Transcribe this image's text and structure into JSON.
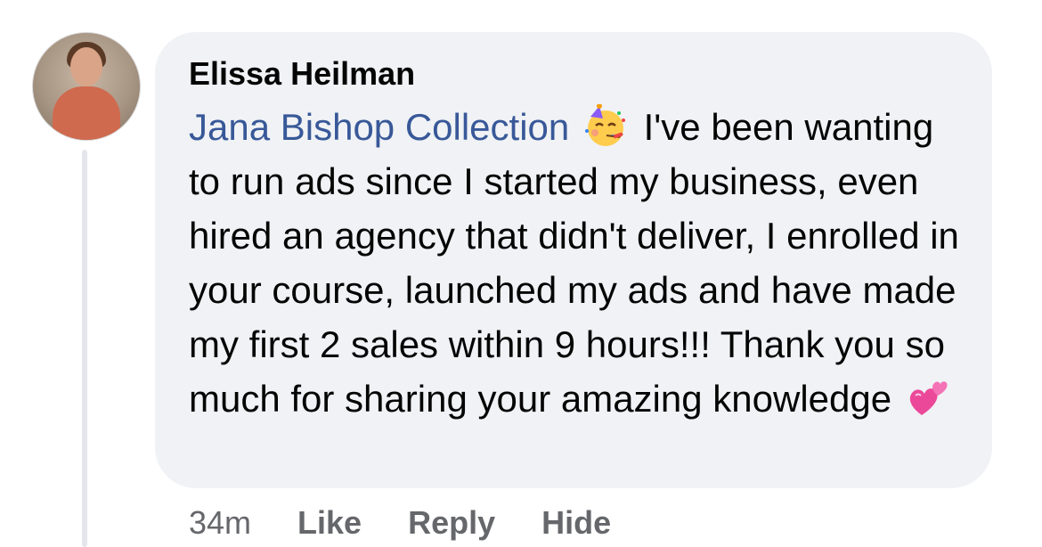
{
  "comment": {
    "author": "Elissa Heilman",
    "mention": "Jana Bishop Collection",
    "text_1": "I've been wanting to run ads since I started my business, even hired an agency that didn't deliver, I enrolled in your course, launched my ads and have made my first 2 sales within 9 hours!!! Thank you so much for sharing your amazing knowledge",
    "emoji_1": "partying-face-emoji",
    "emoji_2": "two-hearts-emoji",
    "time": "34m",
    "like_label": "Like",
    "reply_label": "Reply",
    "hide_label": "Hide"
  },
  "colors": {
    "bubble": "#f0f2f5",
    "mention": "#385898",
    "meta": "#65676b",
    "text": "#050505"
  }
}
